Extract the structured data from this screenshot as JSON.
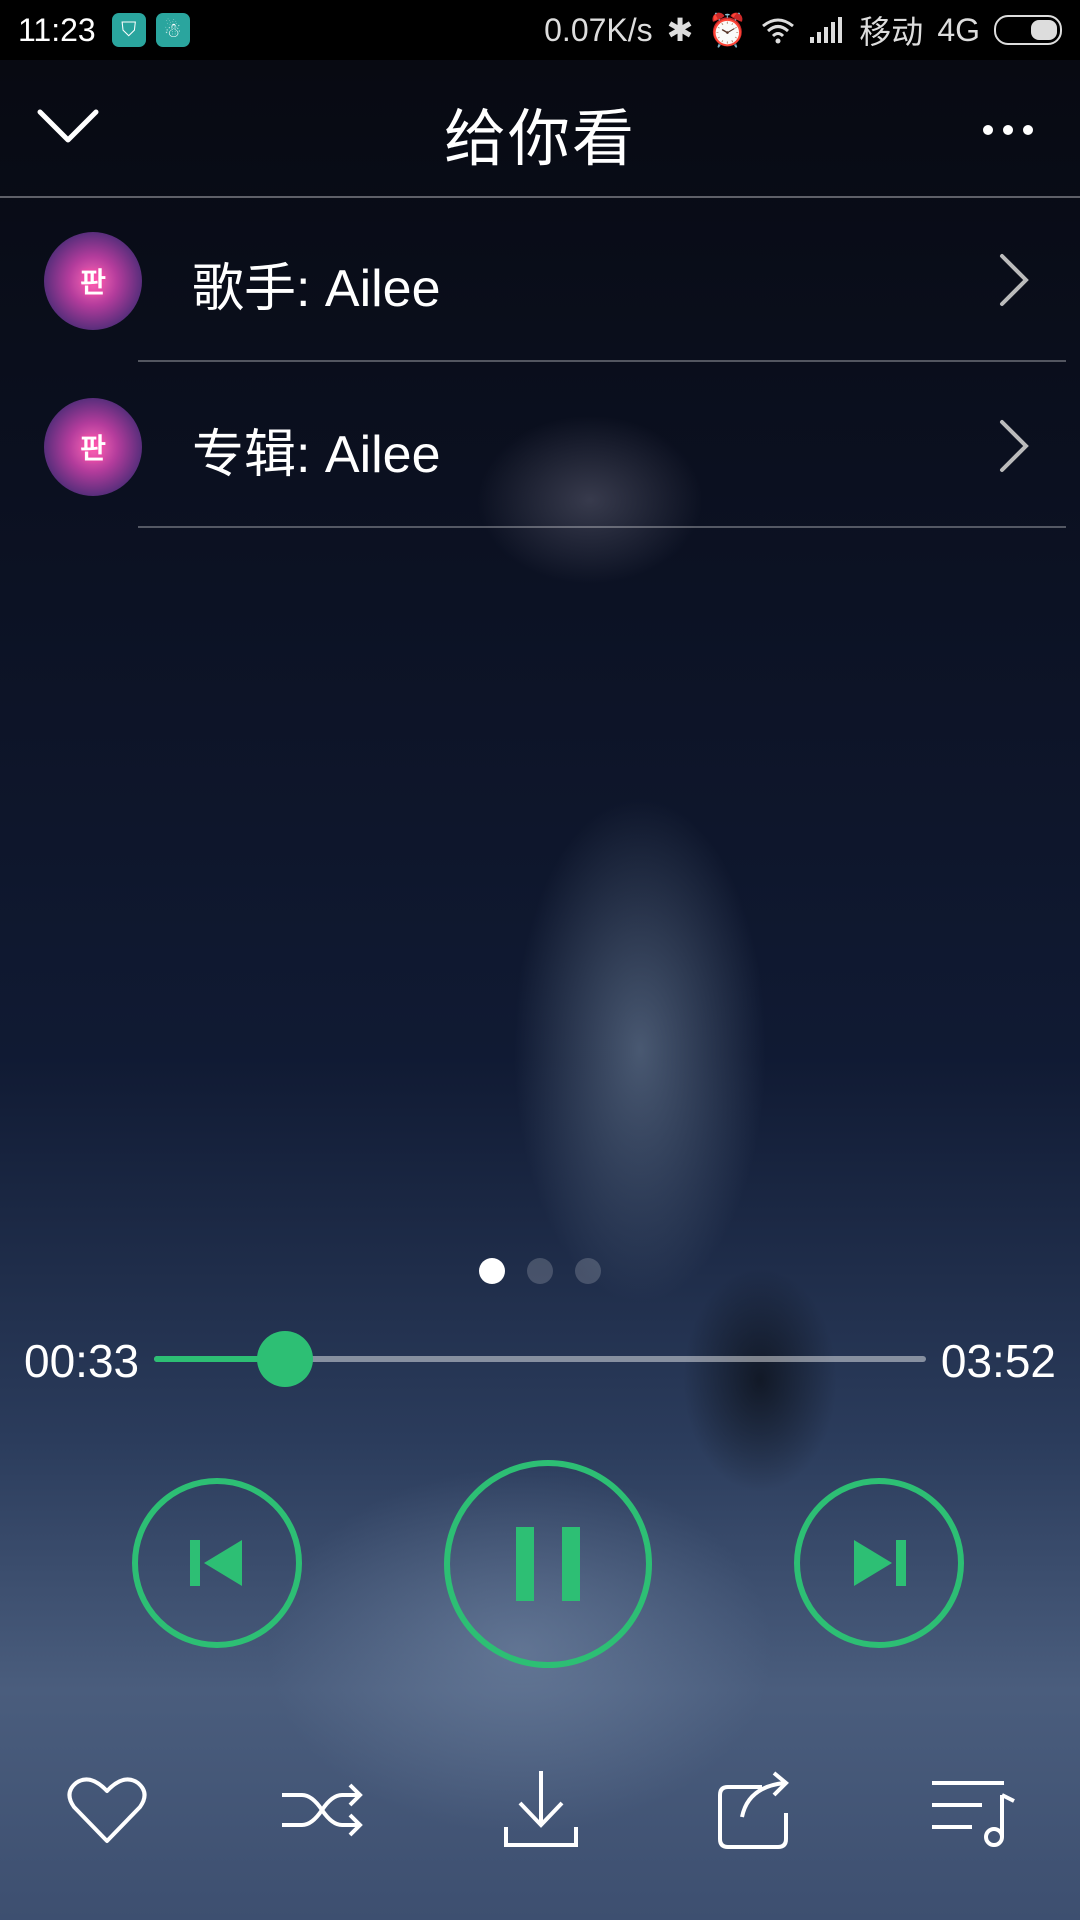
{
  "status_bar": {
    "time": "11:23",
    "net_speed": "0.07K/s",
    "carrier": "移动",
    "network": "4G"
  },
  "header": {
    "title": "给你看"
  },
  "info": [
    {
      "label": "歌手: Ailee",
      "thumb_text": "판"
    },
    {
      "label": "专辑: Ailee",
      "thumb_text": "판"
    }
  ],
  "pager": {
    "count": 3,
    "active": 0
  },
  "player": {
    "current_time": "00:33",
    "total_time": "03:52",
    "progress_fraction": 0.17
  },
  "colors": {
    "accent": "#2dbf74"
  },
  "icons": {
    "collapse": "chevron-down-icon",
    "more": "more-icon",
    "prev": "skip-previous-icon",
    "pause": "pause-icon",
    "next": "skip-next-icon",
    "favorite": "heart-icon",
    "shuffle": "shuffle-icon",
    "download": "download-icon",
    "share": "share-icon",
    "playlist": "playlist-icon"
  }
}
